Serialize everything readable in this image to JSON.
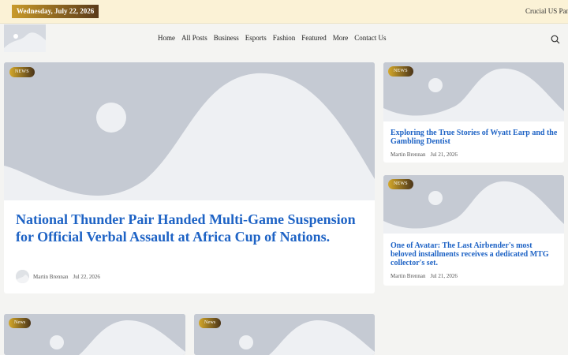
{
  "topbar": {
    "date": "Wednesday, July 22, 2026",
    "ticker": "Crucial US Pane"
  },
  "nav": {
    "items": [
      "Home",
      "All Posts",
      "Business",
      "Esports",
      "Fashion",
      "Featured",
      "More",
      "Contact Us"
    ]
  },
  "featured": {
    "badge": "NEWS",
    "title": "National Thunder Pair Handed Multi-Game Suspension for Official Verbal Assault at Africa Cup of Nations.",
    "author": "Martin Brennan",
    "date": "Jul 22, 2026"
  },
  "side_cards": [
    {
      "badge": "NEWS",
      "title": "Exploring the True Stories of Wyatt Earp and the Gambling Dentist",
      "author": "Martin Brennan",
      "date": "Jul 21, 2026"
    },
    {
      "badge": "NEWS",
      "title": "One of Avatar: The Last Airbender's most beloved installments receives a dedicated MTG collector's set.",
      "author": "Martin Brennan",
      "date": "Jul 21, 2026"
    }
  ],
  "bottom_cards": [
    {
      "badge": "News"
    },
    {
      "badge": "News"
    }
  ],
  "colors": {
    "accent_title": "#1e63c5",
    "topbar_bg": "#fbf2d6",
    "placeholder": "#c5cad3"
  }
}
